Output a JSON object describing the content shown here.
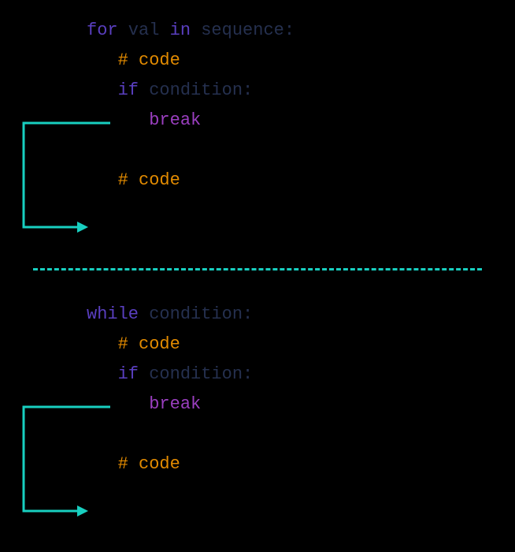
{
  "colors": {
    "background": "#000000",
    "keyword": "#5a3fc0",
    "identifier": "#25304f",
    "comment": "#e38b00",
    "break": "#9b3fc0",
    "accent": "#18cfc0"
  },
  "top": {
    "l1_for": "for",
    "l1_val": " val ",
    "l1_in": "in",
    "l1_seq": " sequence",
    "l1_colon": ":",
    "l2_comment": "# code",
    "l3_if": "if",
    "l3_cond": " condition",
    "l3_colon": ":",
    "l4_break": "break",
    "l5_comment": "# code"
  },
  "bottom": {
    "l1_while": "while",
    "l1_cond": " condition",
    "l1_colon": ":",
    "l2_comment": "# code",
    "l3_if": "if",
    "l3_cond": " condition",
    "l3_colon": ":",
    "l4_break": "break",
    "l5_comment": "# code"
  }
}
